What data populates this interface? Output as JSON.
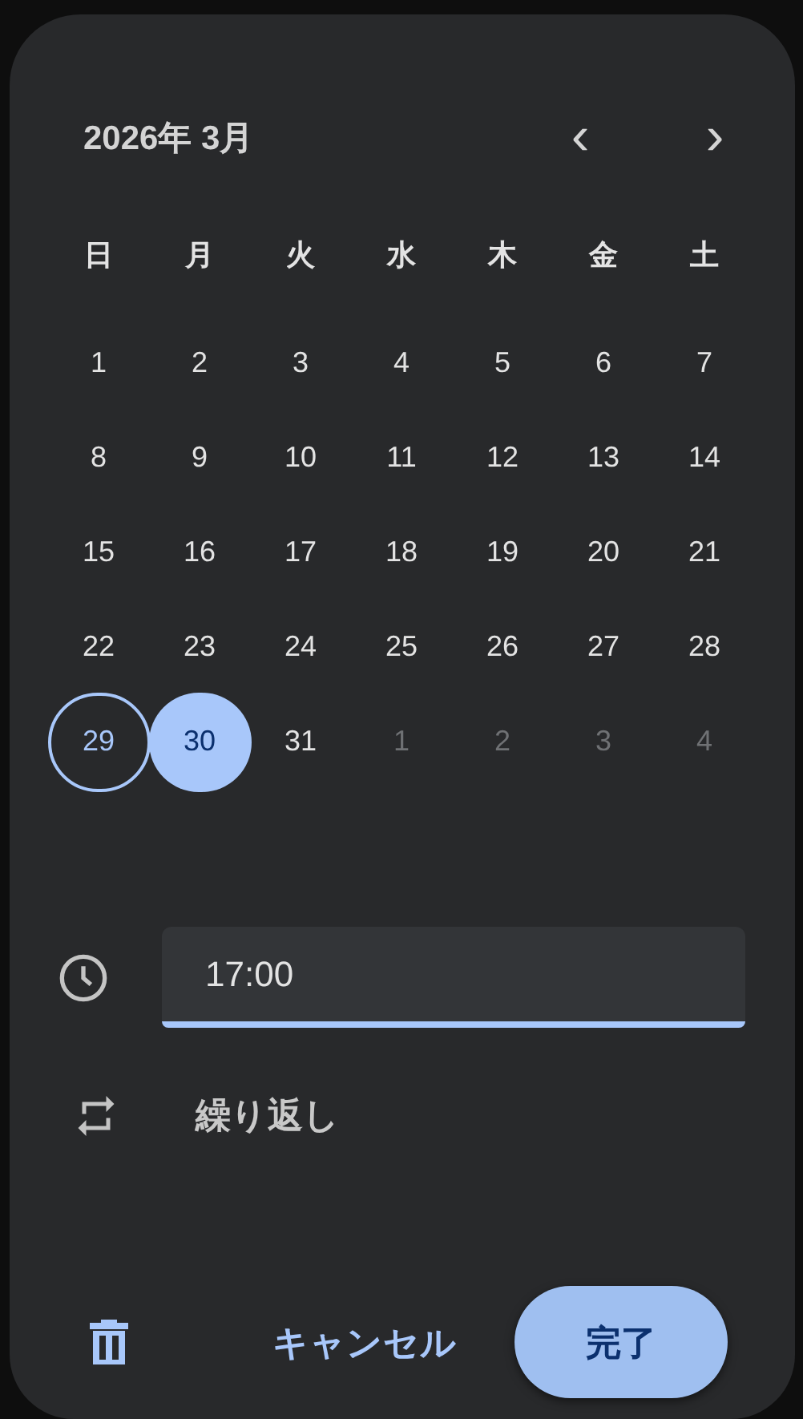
{
  "calendar": {
    "title": "2026年 3月",
    "prev_label": "‹",
    "next_label": "›",
    "weekdays": [
      "日",
      "月",
      "火",
      "水",
      "木",
      "金",
      "土"
    ],
    "days": [
      {
        "label": "1",
        "kind": "current",
        "today": false,
        "selected": false
      },
      {
        "label": "2",
        "kind": "current",
        "today": false,
        "selected": false
      },
      {
        "label": "3",
        "kind": "current",
        "today": false,
        "selected": false
      },
      {
        "label": "4",
        "kind": "current",
        "today": false,
        "selected": false
      },
      {
        "label": "5",
        "kind": "current",
        "today": false,
        "selected": false
      },
      {
        "label": "6",
        "kind": "current",
        "today": false,
        "selected": false
      },
      {
        "label": "7",
        "kind": "current",
        "today": false,
        "selected": false
      },
      {
        "label": "8",
        "kind": "current",
        "today": false,
        "selected": false
      },
      {
        "label": "9",
        "kind": "current",
        "today": false,
        "selected": false
      },
      {
        "label": "10",
        "kind": "current",
        "today": false,
        "selected": false
      },
      {
        "label": "11",
        "kind": "current",
        "today": false,
        "selected": false
      },
      {
        "label": "12",
        "kind": "current",
        "today": false,
        "selected": false
      },
      {
        "label": "13",
        "kind": "current",
        "today": false,
        "selected": false
      },
      {
        "label": "14",
        "kind": "current",
        "today": false,
        "selected": false
      },
      {
        "label": "15",
        "kind": "current",
        "today": false,
        "selected": false
      },
      {
        "label": "16",
        "kind": "current",
        "today": false,
        "selected": false
      },
      {
        "label": "17",
        "kind": "current",
        "today": false,
        "selected": false
      },
      {
        "label": "18",
        "kind": "current",
        "today": false,
        "selected": false
      },
      {
        "label": "19",
        "kind": "current",
        "today": false,
        "selected": false
      },
      {
        "label": "20",
        "kind": "current",
        "today": false,
        "selected": false
      },
      {
        "label": "21",
        "kind": "current",
        "today": false,
        "selected": false
      },
      {
        "label": "22",
        "kind": "current",
        "today": false,
        "selected": false
      },
      {
        "label": "23",
        "kind": "current",
        "today": false,
        "selected": false
      },
      {
        "label": "24",
        "kind": "current",
        "today": false,
        "selected": false
      },
      {
        "label": "25",
        "kind": "current",
        "today": false,
        "selected": false
      },
      {
        "label": "26",
        "kind": "current",
        "today": false,
        "selected": false
      },
      {
        "label": "27",
        "kind": "current",
        "today": false,
        "selected": false
      },
      {
        "label": "28",
        "kind": "current",
        "today": false,
        "selected": false
      },
      {
        "label": "29",
        "kind": "current",
        "today": true,
        "selected": false
      },
      {
        "label": "30",
        "kind": "current",
        "today": false,
        "selected": true
      },
      {
        "label": "31",
        "kind": "current",
        "today": false,
        "selected": false
      },
      {
        "label": "1",
        "kind": "outside",
        "today": false,
        "selected": false
      },
      {
        "label": "2",
        "kind": "outside",
        "today": false,
        "selected": false
      },
      {
        "label": "3",
        "kind": "outside",
        "today": false,
        "selected": false
      },
      {
        "label": "4",
        "kind": "outside",
        "today": false,
        "selected": false
      }
    ]
  },
  "time_field": {
    "value": "17:00"
  },
  "repeat": {
    "label": "繰り返し"
  },
  "buttons": {
    "cancel": "キャンセル",
    "done": "完了"
  }
}
